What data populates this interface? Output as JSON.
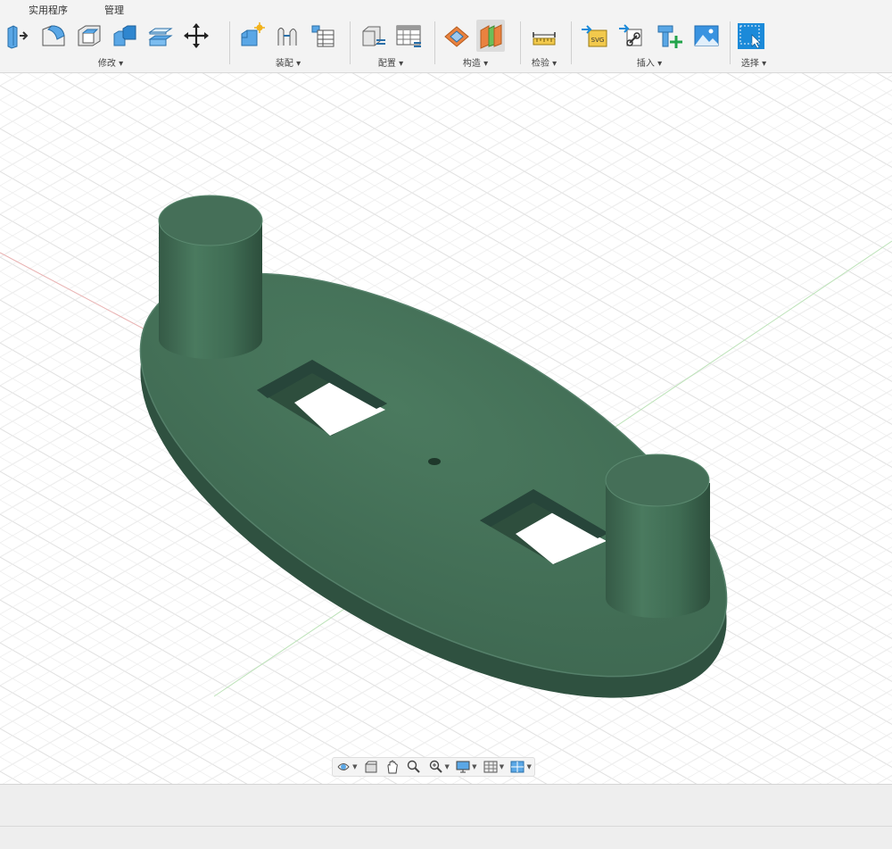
{
  "menu": {
    "tabs": [
      "实用程序",
      "管理"
    ]
  },
  "toolbar": {
    "groups": [
      {
        "label": "修改 ▾",
        "icons": [
          "press-pull-icon",
          "fillet-icon",
          "shell-icon",
          "combine-icon",
          "offset-face-icon",
          "move-icon"
        ]
      },
      {
        "label": "装配 ▾",
        "icons": [
          "new-component-icon",
          "joint-icon",
          "table-icon"
        ]
      },
      {
        "label": "配置 ▾",
        "icons": [
          "configure-icon",
          "configuration-table-icon"
        ]
      },
      {
        "label": "构造 ▾",
        "icons": [
          "offset-plane-icon",
          "midplane-icon"
        ]
      },
      {
        "label": "检验 ▾",
        "icons": [
          "measure-icon"
        ]
      },
      {
        "label": "插入 ▾",
        "icons": [
          "insert-svg-icon",
          "insert-derive-icon",
          "insert-mesh-icon",
          "insert-canvas-icon"
        ]
      },
      {
        "label": "选择 ▾",
        "icons": [
          "select-icon"
        ]
      }
    ]
  },
  "colors": {
    "model": "#426b54",
    "model_dark": "#2f5140",
    "model_edge": "#55806a",
    "grid": "#e3e3e3",
    "accent_blue": "#1b8ad9",
    "x_axis": "#e7a9a9",
    "y_axis": "#b4dfb1"
  },
  "navbar": {
    "icons": [
      "orbit-icon",
      "look-at-icon",
      "pan-icon",
      "zoom-icon",
      "fit-icon",
      "display-settings-icon",
      "grid-settings-icon",
      "viewports-icon"
    ]
  }
}
